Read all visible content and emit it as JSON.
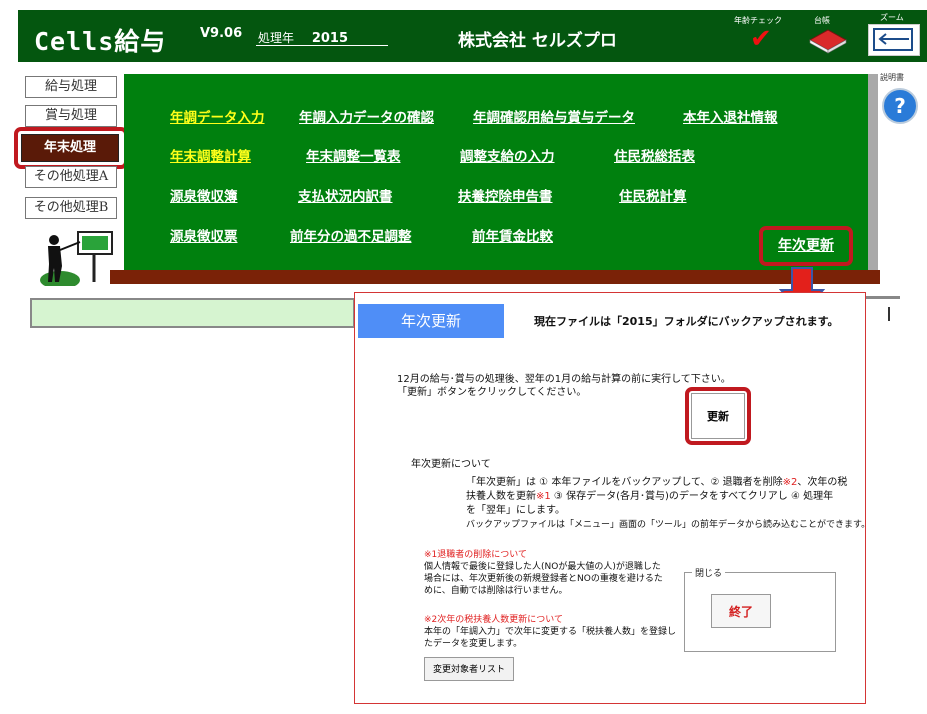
{
  "colors": {
    "header_bg": "#04560f",
    "board_bg": "#00800e",
    "highlight_red": "#c0191f",
    "menu_yellow": "#ffff1a",
    "dialog_tab_blue": "#4f8ef7"
  },
  "header": {
    "app_title": "Cells給与",
    "version": "V9.06",
    "year_label": "処理年",
    "year_value": "2015",
    "company": "株式会社 セルズプロ",
    "age_check_label": "年齢チェック",
    "ledger_label": "台帳",
    "zoom_label": "ズーム",
    "icons": {
      "age_check": "checkmark-icon",
      "ledger": "book-icon",
      "zoom": "zoom-icon"
    }
  },
  "sidebar": {
    "items": [
      {
        "label": "給与処理"
      },
      {
        "label": "賞与処理"
      },
      {
        "label": "年末処理"
      },
      {
        "label": "その他処理A"
      },
      {
        "label": "その他処理B"
      }
    ]
  },
  "board": {
    "rows": [
      [
        "年調データ入力",
        "年調入力データの確認",
        "年調確認用給与賞与データ",
        "本年入退社情報"
      ],
      [
        "年末調整計算",
        "年末調整一覧表",
        "調整支給の入力",
        "住民税総括表"
      ],
      [
        "源泉徴収簿",
        "支払状況内訳書",
        "扶養控除申告書",
        "住民税計算"
      ],
      [
        "源泉徴収票",
        "前年分の過不足調整",
        "前年賃金比較"
      ]
    ],
    "annual_update_button": "年次更新"
  },
  "help": {
    "label": "説明書",
    "icon": "question-icon"
  },
  "dialog": {
    "title": "年次更新",
    "banner": "現在ファイルは「2015」フォルダにバックアップされます。",
    "instruction_line1": "12月の給与･賞与の処理後、翌年の1月の給与計算の前に実行して下さい。",
    "instruction_line2": "「更新」ボタンをクリックしてください。",
    "update_button": "更新",
    "about_heading": "年次更新について",
    "about_l1_a": "「年次更新」は ① 本年ファイルをバックアップして、② 退職者を削除",
    "about_l1_note": "※2",
    "about_l1_b": "、次年の税",
    "about_l2_a": "扶養人数を更新",
    "about_l2_note": "※1",
    "about_l2_b": " ③ 保存データ(各月･賞与)のデータをすべてクリアし ④ 処理年",
    "about_l3": "を「翌年」にします。",
    "about_l4": "バックアップファイルは「メニュー」画面の「ツール」の前年データから読み込むことができます。",
    "note1_title": "※1退職者の削除について",
    "note1_l1": "個人情報で最後に登録した人(NOが最大値の人)が退職した",
    "note1_l2": "場合には、年次更新後の新規登録者とNOの重複を避けるた",
    "note1_l3": "めに、自動では削除は行いません。",
    "note2_title": "※2次年の税扶養人数更新について",
    "note2_l1": "本年の「年調入力」で次年に変更する「税扶養人数」を登録し",
    "note2_l2": "たデータを変更します。",
    "close_group_label": "閉じる",
    "close_button": "終了",
    "target_list_button": "変更対象者リスト"
  }
}
